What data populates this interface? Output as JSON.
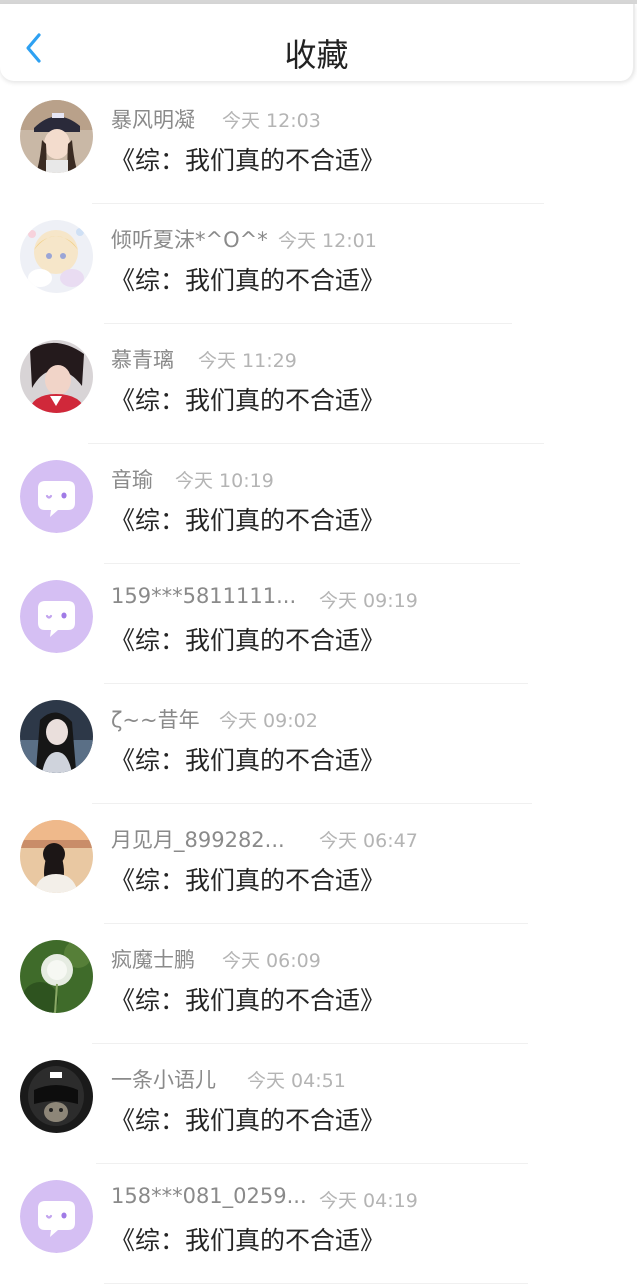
{
  "header": {
    "title": "收藏",
    "back_icon": "chevron-left-icon",
    "accent": "#2ea1f2"
  },
  "items": [
    {
      "name": "暴风明凝",
      "time": "今天 12:03",
      "message": "《综：我们真的不合适》",
      "avatar": "photo-girl-cap"
    },
    {
      "name": "倾听夏沫*^O^*",
      "time": "今天 12:01",
      "message": "《综：我们真的不合适》",
      "avatar": "anime-girl"
    },
    {
      "name": "慕青璃",
      "time": "今天 11:29",
      "message": "《综：我们真的不合适》",
      "avatar": "photo-girl"
    },
    {
      "name": "音瑜",
      "time": "今天 10:19",
      "message": "《综：我们真的不合适》",
      "avatar": "default-chat-icon"
    },
    {
      "name": "159***5811111...",
      "time": "今天 09:19",
      "message": "《综：我们真的不合适》",
      "avatar": "default-chat-icon"
    },
    {
      "name": "ζ~~昔年",
      "time": "今天 09:02",
      "message": "《综：我们真的不合适》",
      "avatar": "anime-dark"
    },
    {
      "name": "月见月_899282...",
      "time": "今天 06:47",
      "message": "《综：我们真的不合适》",
      "avatar": "photo-back"
    },
    {
      "name": "疯魔士鹏",
      "time": "今天 06:09",
      "message": "《综：我们真的不合适》",
      "avatar": "dandelion"
    },
    {
      "name": "一条小语儿",
      "time": "今天 04:51",
      "message": "《综：我们真的不合适》",
      "avatar": "cat-helmet"
    },
    {
      "name": "158***081_0259...",
      "time": "今天 04:19",
      "message": "《综：我们真的不合适》",
      "avatar": "default-chat-icon"
    }
  ]
}
